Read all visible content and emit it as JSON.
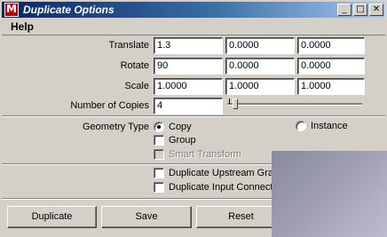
{
  "window": {
    "title": "Duplicate Options",
    "app_icon_letter": "M",
    "title_buttons": {
      "minimize": "_",
      "maximize": "□",
      "close": "✕"
    }
  },
  "menu": {
    "items": [
      {
        "label": "Help"
      }
    ]
  },
  "rows": {
    "translate": {
      "label": "Translate",
      "values": [
        "1.3",
        "0.0000",
        "0.0000"
      ]
    },
    "rotate": {
      "label": "Rotate",
      "values": [
        "90",
        "0.0000",
        "0.0000"
      ]
    },
    "scale": {
      "label": "Scale",
      "values": [
        "1.0000",
        "1.0000",
        "1.0000"
      ]
    },
    "copies": {
      "label": "Number of Copies",
      "value": "4"
    }
  },
  "geometry": {
    "label": "Geometry Type",
    "copy_label": "Copy",
    "instance_label": "Instance",
    "selected": "Copy",
    "group_label": "Group",
    "smart_transform_label": "Smart Transform"
  },
  "duplicate_options": {
    "upstream_label": "Duplicate Upstream Grap",
    "input_connections_label": "Duplicate Input Connect"
  },
  "buttons": {
    "duplicate": "Duplicate",
    "save": "Save",
    "reset": "Reset"
  }
}
